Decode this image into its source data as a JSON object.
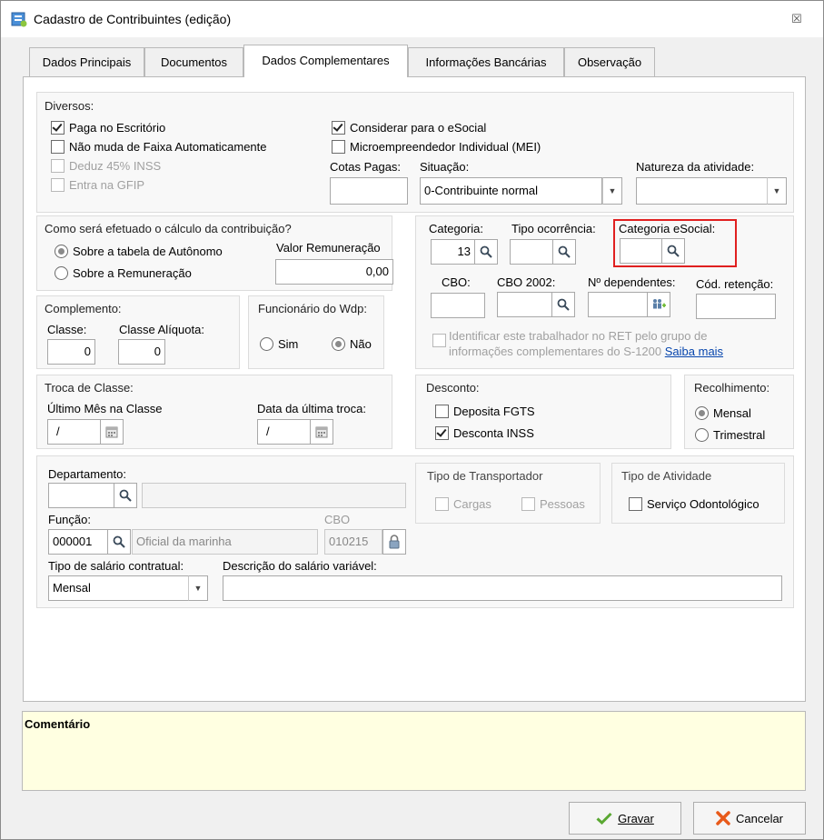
{
  "window": {
    "title": "Cadastro de Contribuintes (edição)",
    "close_symbol": "☒"
  },
  "tabs": [
    {
      "label": "Dados Principais"
    },
    {
      "label": "Documentos"
    },
    {
      "label": "Dados Complementares"
    },
    {
      "label": "Informações Bancárias"
    },
    {
      "label": "Observação"
    }
  ],
  "diversos": {
    "label": "Diversos:",
    "paga_escritorio": "Paga no Escritório",
    "nao_muda_faixa": "Não muda de Faixa Automaticamente",
    "deduz_inss": "Deduz 45% INSS",
    "entra_gfip": "Entra na GFIP",
    "considerar_esocial": "Considerar para o eSocial",
    "mei": "Microempreendedor Individual (MEI)",
    "cotas_label": "Cotas Pagas:",
    "cotas_value": "",
    "situacao_label": "Situação:",
    "situacao_value": "0-Contribuinte normal",
    "natureza_label": "Natureza da atividade:",
    "natureza_value": ""
  },
  "calculo": {
    "label": "Como será efetuado o cálculo da contribuição?",
    "opt_tabela": "Sobre a tabela de Autônomo",
    "opt_remuneracao": "Sobre a Remuneração",
    "valor_label": "Valor Remuneração",
    "valor_value": "0,00"
  },
  "complemento": {
    "label": "Complemento:",
    "classe_label": "Classe:",
    "classe_value": "0",
    "aliquota_label": "Classe Alíquota:",
    "aliquota_value": "0"
  },
  "funcionario": {
    "label": "Funcionário do Wdp:",
    "sim": "Sim",
    "nao": "Não"
  },
  "categoria": {
    "categoria_label": "Categoria:",
    "categoria_value": "13",
    "tipo_ocorrencia_label": "Tipo ocorrência:",
    "tipo_ocorrencia_value": "",
    "categoria_esocial_label": "Categoria eSocial:",
    "categoria_esocial_value": "",
    "cbo_label": "CBO:",
    "cbo_value": "",
    "cbo2002_label": "CBO 2002:",
    "cbo2002_value": "",
    "dependentes_label": "Nº dependentes:",
    "dependentes_value": "",
    "retencao_label": "Cód. retenção:",
    "retencao_value": "",
    "ret_line1": "Identificar este trabalhador no RET pelo grupo de",
    "ret_line2": "informações complementares do S-1200",
    "saiba_mais": "Saiba mais"
  },
  "troca": {
    "label": "Troca de Classe:",
    "ultimo_label": "Último Mês na Classe",
    "ultimo_value": "/",
    "data_label": "Data da última troca:",
    "data_value": "/"
  },
  "desconto": {
    "label": "Desconto:",
    "fgts": "Deposita FGTS",
    "inss": "Desconta INSS"
  },
  "recolhimento": {
    "label": "Recolhimento:",
    "mensal": "Mensal",
    "trimestral": "Trimestral"
  },
  "departamento": {
    "label": "Departamento:",
    "code": "",
    "desc": "",
    "funcao_label": "Função:",
    "funcao_code": "000001",
    "funcao_desc": "Oficial da marinha",
    "cbo_label": "CBO",
    "cbo_value": "010215",
    "tipo_salario_label": "Tipo de salário contratual:",
    "tipo_salario_value": "Mensal",
    "desc_salario_label": "Descrição do salário variável:",
    "desc_salario_value": ""
  },
  "transportador": {
    "label": "Tipo de Transportador",
    "cargas": "Cargas",
    "pessoas": "Pessoas"
  },
  "atividade": {
    "label": "Tipo de Atividade",
    "odonto": "Serviço Odontológico"
  },
  "comentario": {
    "label": "Comentário"
  },
  "buttons": {
    "gravar": "Gravar",
    "cancelar": "Cancelar"
  },
  "colors": {
    "highlight": "#e02020",
    "comment_bg": "#ffffe1",
    "link": "#0645ad"
  }
}
